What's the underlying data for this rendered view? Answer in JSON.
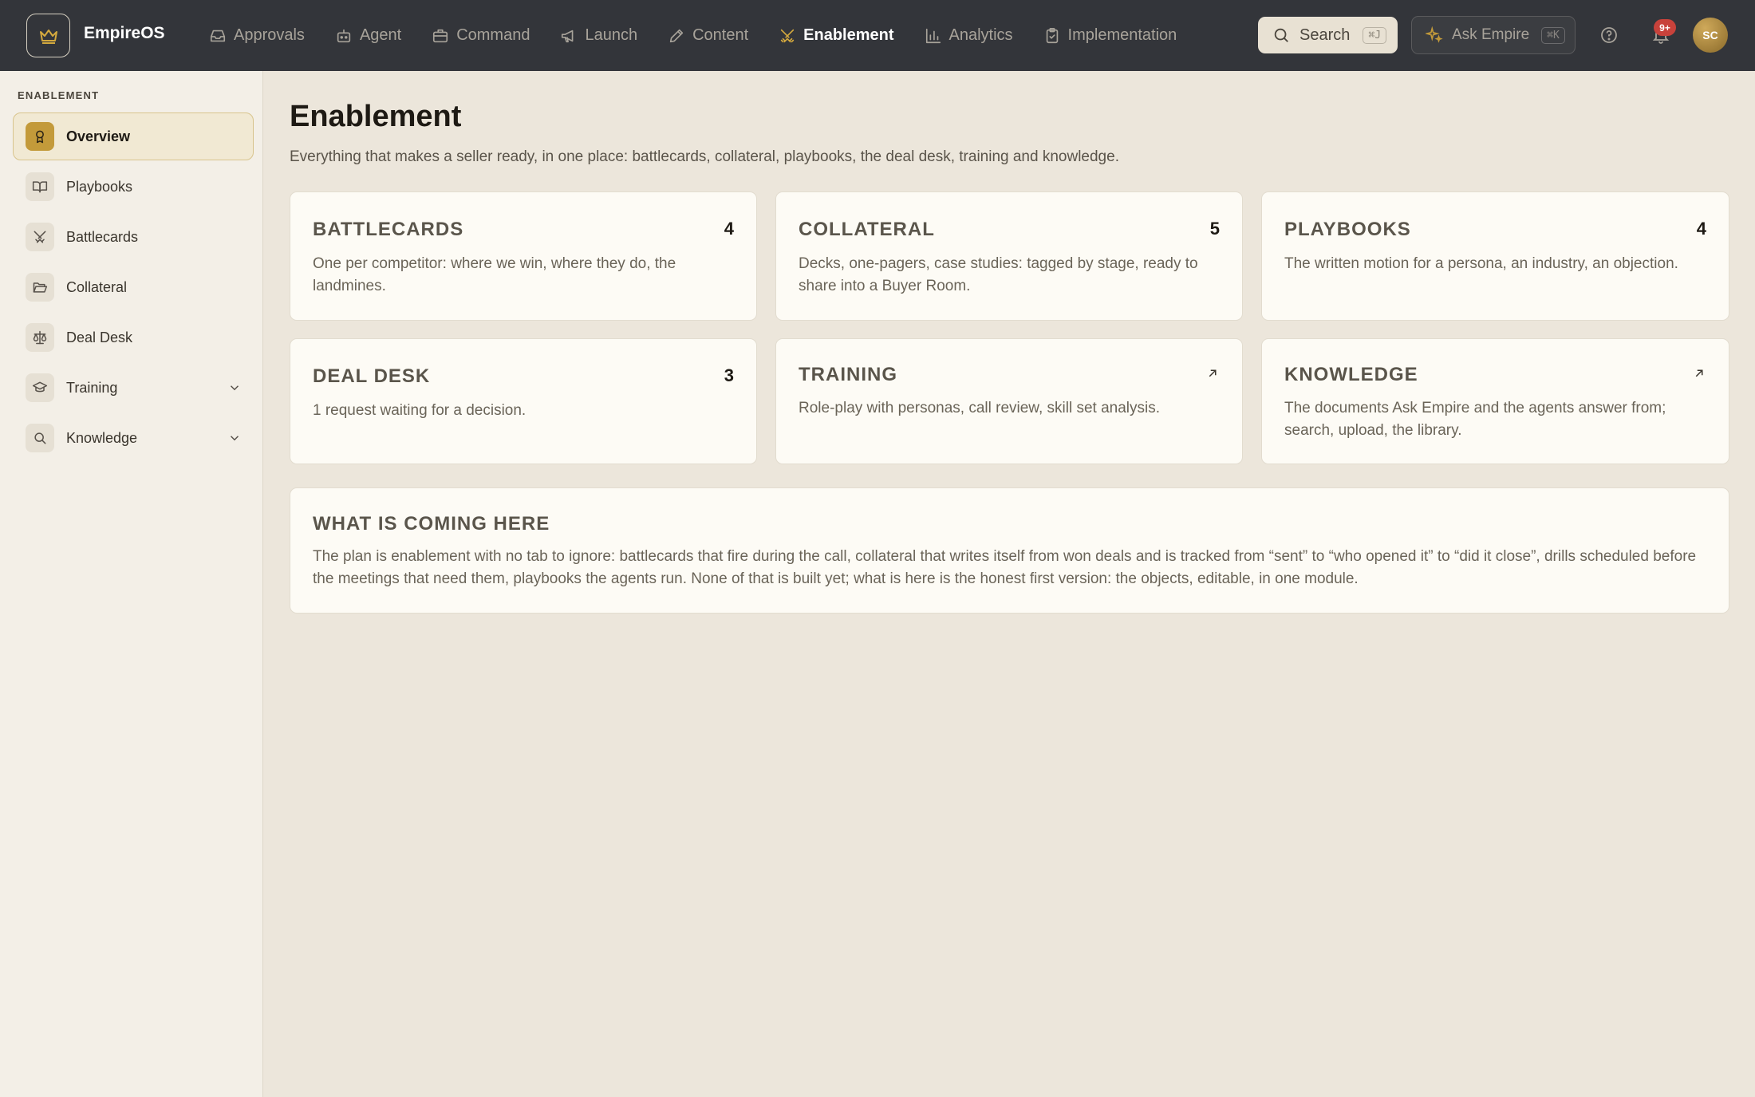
{
  "app": {
    "name": "EmpireOS"
  },
  "nav": [
    {
      "label": "Approvals",
      "icon": "inbox-icon"
    },
    {
      "label": "Agent",
      "icon": "bot-icon"
    },
    {
      "label": "Command",
      "icon": "briefcase-icon"
    },
    {
      "label": "Launch",
      "icon": "megaphone-icon"
    },
    {
      "label": "Content",
      "icon": "pen-icon"
    },
    {
      "label": "Enablement",
      "icon": "swords-icon",
      "active": true
    },
    {
      "label": "Analytics",
      "icon": "bar-chart-icon"
    },
    {
      "label": "Implementation",
      "icon": "clipboard-check-icon"
    }
  ],
  "search": {
    "label": "Search",
    "shortcut": "⌘J"
  },
  "ask": {
    "label": "Ask Empire",
    "shortcut": "⌘K"
  },
  "notifications": {
    "badge": "9+"
  },
  "user": {
    "initials": "SC"
  },
  "sidebar": {
    "heading": "ENABLEMENT",
    "items": [
      {
        "label": "Overview",
        "icon": "award-icon",
        "active": true
      },
      {
        "label": "Playbooks",
        "icon": "book-open-icon"
      },
      {
        "label": "Battlecards",
        "icon": "swords-icon"
      },
      {
        "label": "Collateral",
        "icon": "folder-open-icon"
      },
      {
        "label": "Deal Desk",
        "icon": "scale-icon"
      },
      {
        "label": "Training",
        "icon": "graduation-cap-icon",
        "expandable": true
      },
      {
        "label": "Knowledge",
        "icon": "search-icon",
        "expandable": true
      }
    ]
  },
  "page": {
    "title": "Enablement",
    "subtitle": "Everything that makes a seller ready, in one place: battlecards, collateral, playbooks, the deal desk, training and knowledge."
  },
  "cards": [
    {
      "title": "BATTLECARDS",
      "count": "4",
      "desc": "One per competitor: where we win, where they do, the landmines."
    },
    {
      "title": "COLLATERAL",
      "count": "5",
      "desc": "Decks, one-pagers, case studies: tagged by stage, ready to share into a Buyer Room."
    },
    {
      "title": "PLAYBOOKS",
      "count": "4",
      "desc": "The written motion for a persona, an industry, an objection."
    },
    {
      "title": "DEAL DESK",
      "count": "3",
      "desc": "1 request waiting for a decision."
    },
    {
      "title": "TRAINING",
      "desc": "Role-play with personas, call review, skill set analysis."
    },
    {
      "title": "KNOWLEDGE",
      "desc": "The documents Ask Empire and the agents answer from; search, upload, the library."
    }
  ],
  "coming": {
    "title": "WHAT IS COMING HERE",
    "desc": "The plan is enablement with no tab to ignore: battlecards that fire during the call, collateral that writes itself from won deals and is tracked from “sent” to “who opened it” to “did it close”, drills scheduled before the meetings that need them, playbooks the agents run. None of that is built yet; what is here is the honest first version: the objects, editable, in one module."
  },
  "colors": {
    "accent": "#c39a3a",
    "topbar": "#33353a",
    "background": "#ece6db",
    "badge": "#c8423b"
  }
}
